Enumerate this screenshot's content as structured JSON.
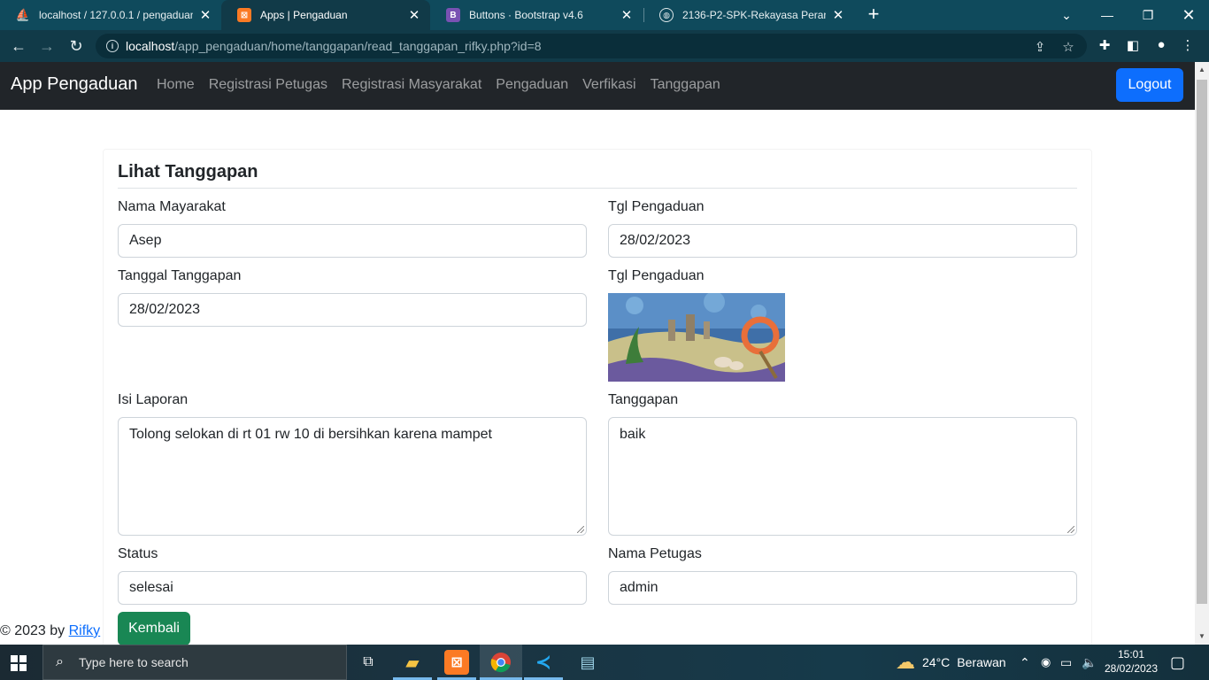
{
  "browser": {
    "tabs": [
      {
        "title": "localhost / 127.0.0.1 / pengaduan",
        "favicon": "phpmyadmin-icon",
        "active": false
      },
      {
        "title": "Apps | Pengaduan",
        "favicon": "xampp-icon",
        "active": true
      },
      {
        "title": "Buttons · Bootstrap v4.6",
        "favicon": "bootstrap-icon",
        "active": false
      },
      {
        "title": "2136-P2-SPK-Rekayasa Perangkat",
        "favicon": "globe-icon",
        "active": false
      }
    ],
    "url_host": "localhost",
    "url_path": "/app_pengaduan/home/tanggapan/read_tanggapan_rifky.php?id=8"
  },
  "navbar": {
    "brand": "App Pengaduan",
    "links": [
      "Home",
      "Registrasi Petugas",
      "Registrasi Masyarakat",
      "Pengaduan",
      "Verfikasi",
      "Tanggapan"
    ],
    "logout_label": "Logout",
    "logout_color": "#0d6efd"
  },
  "card": {
    "title": "Lihat Tanggapan",
    "nama_label": "Nama Mayarakat",
    "nama_value": "Asep",
    "tgl_pengaduan_label": "Tgl Pengaduan",
    "tgl_pengaduan_value": "28/02/2023",
    "tanggal_tanggapan_label": "Tanggal Tanggapan",
    "tanggal_tanggapan_value": "28/02/2023",
    "foto_label": "Tgl Pengaduan",
    "isi_laporan_label": "Isi Laporan",
    "isi_laporan_value": "Tolong selokan di rt 01 rw 10 di bersihkan karena mampet",
    "tanggapan_label": "Tanggapan",
    "tanggapan_value": "baik",
    "status_label": "Status",
    "status_value": "selesai",
    "petugas_label": "Nama Petugas",
    "petugas_value": "admin",
    "kembali_label": "Kembali",
    "kembali_color": "#198754"
  },
  "footer": {
    "text": "© 2023 by ",
    "link": "Rifky"
  },
  "taskbar": {
    "search_placeholder": "Type here to search",
    "weather_temp": "24°C",
    "weather_desc": "Berawan",
    "time": "15:01",
    "date": "28/02/2023"
  }
}
